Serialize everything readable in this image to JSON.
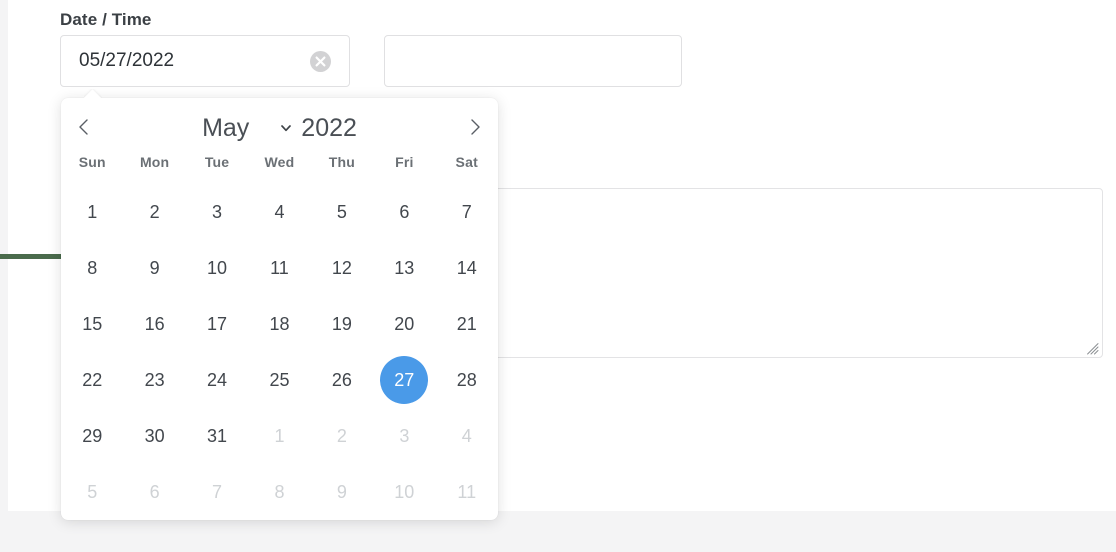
{
  "theme": {
    "page_background": "#f4f4f5",
    "card_background": "#ffffff",
    "selected_day_color": "#4a9ae8",
    "rule_color": "#4a6b4c",
    "border_color": "#e0e0e2",
    "text_color": "#42474d",
    "muted_text_color": "#cfd2d5"
  },
  "form": {
    "label": "Date / Time",
    "date_field": {
      "value": "05/27/2022",
      "placeholder": "",
      "clear_icon": "clear-circle-icon"
    },
    "time_field": {
      "value": "",
      "placeholder": ""
    },
    "notes_field": {
      "value": "",
      "placeholder": ""
    }
  },
  "calendar": {
    "prev_icon": "chevron-left-icon",
    "next_icon": "chevron-right-icon",
    "month": "May",
    "month_dropdown_icon": "chevron-down-icon",
    "year": "2022",
    "weekdays": [
      "Sun",
      "Mon",
      "Tue",
      "Wed",
      "Thu",
      "Fri",
      "Sat"
    ],
    "selected_day": 27,
    "days": [
      {
        "label": "1",
        "outside": false,
        "selected": false
      },
      {
        "label": "2",
        "outside": false,
        "selected": false
      },
      {
        "label": "3",
        "outside": false,
        "selected": false
      },
      {
        "label": "4",
        "outside": false,
        "selected": false
      },
      {
        "label": "5",
        "outside": false,
        "selected": false
      },
      {
        "label": "6",
        "outside": false,
        "selected": false
      },
      {
        "label": "7",
        "outside": false,
        "selected": false
      },
      {
        "label": "8",
        "outside": false,
        "selected": false
      },
      {
        "label": "9",
        "outside": false,
        "selected": false
      },
      {
        "label": "10",
        "outside": false,
        "selected": false
      },
      {
        "label": "11",
        "outside": false,
        "selected": false
      },
      {
        "label": "12",
        "outside": false,
        "selected": false
      },
      {
        "label": "13",
        "outside": false,
        "selected": false
      },
      {
        "label": "14",
        "outside": false,
        "selected": false
      },
      {
        "label": "15",
        "outside": false,
        "selected": false
      },
      {
        "label": "16",
        "outside": false,
        "selected": false
      },
      {
        "label": "17",
        "outside": false,
        "selected": false
      },
      {
        "label": "18",
        "outside": false,
        "selected": false
      },
      {
        "label": "19",
        "outside": false,
        "selected": false
      },
      {
        "label": "20",
        "outside": false,
        "selected": false
      },
      {
        "label": "21",
        "outside": false,
        "selected": false
      },
      {
        "label": "22",
        "outside": false,
        "selected": false
      },
      {
        "label": "23",
        "outside": false,
        "selected": false
      },
      {
        "label": "24",
        "outside": false,
        "selected": false
      },
      {
        "label": "25",
        "outside": false,
        "selected": false
      },
      {
        "label": "26",
        "outside": false,
        "selected": false
      },
      {
        "label": "27",
        "outside": false,
        "selected": true
      },
      {
        "label": "28",
        "outside": false,
        "selected": false
      },
      {
        "label": "29",
        "outside": false,
        "selected": false
      },
      {
        "label": "30",
        "outside": false,
        "selected": false
      },
      {
        "label": "31",
        "outside": false,
        "selected": false
      },
      {
        "label": "1",
        "outside": true,
        "selected": false
      },
      {
        "label": "2",
        "outside": true,
        "selected": false
      },
      {
        "label": "3",
        "outside": true,
        "selected": false
      },
      {
        "label": "4",
        "outside": true,
        "selected": false
      },
      {
        "label": "5",
        "outside": true,
        "selected": false
      },
      {
        "label": "6",
        "outside": true,
        "selected": false
      },
      {
        "label": "7",
        "outside": true,
        "selected": false
      },
      {
        "label": "8",
        "outside": true,
        "selected": false
      },
      {
        "label": "9",
        "outside": true,
        "selected": false
      },
      {
        "label": "10",
        "outside": true,
        "selected": false
      },
      {
        "label": "11",
        "outside": true,
        "selected": false
      }
    ]
  }
}
